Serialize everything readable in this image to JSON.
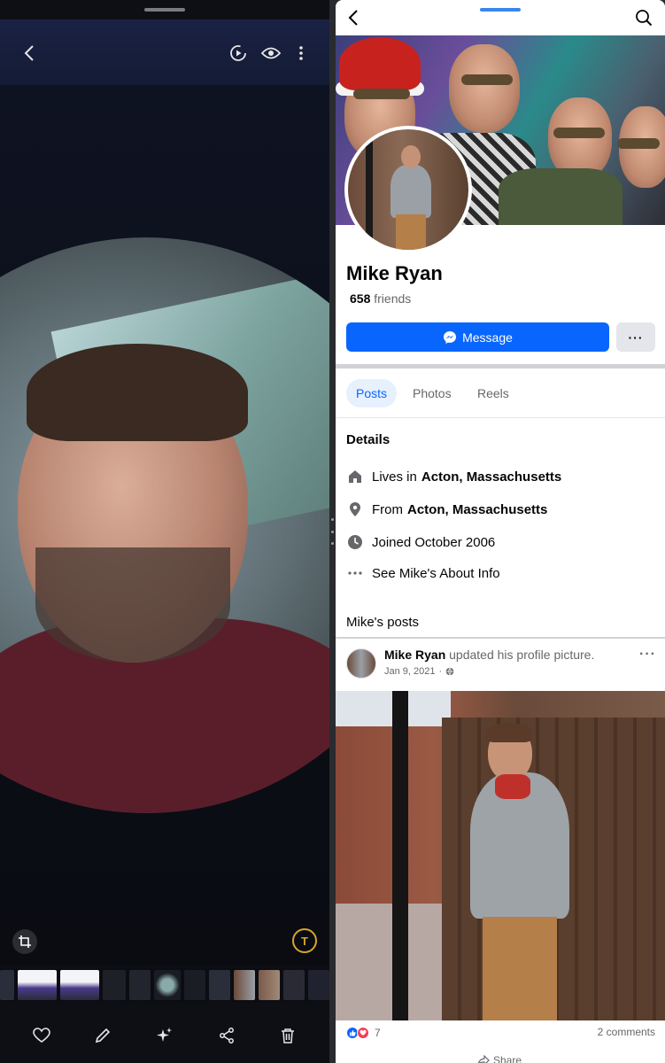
{
  "gallery": {
    "top_icons": [
      "back-icon",
      "motion-photo-icon",
      "eye-icon",
      "more-vertical-icon"
    ],
    "text_button_label": "T",
    "bottom_actions": [
      "heart-icon",
      "edit-icon",
      "sparkle-icon",
      "share-icon",
      "trash-icon"
    ],
    "filmstrip_count": 13
  },
  "facebook": {
    "profile": {
      "name": "Mike Ryan",
      "friends_count": "658",
      "friends_label": "friends"
    },
    "buttons": {
      "message": "Message",
      "more": "···"
    },
    "tabs": [
      {
        "label": "Posts",
        "active": true
      },
      {
        "label": "Photos",
        "active": false
      },
      {
        "label": "Reels",
        "active": false
      }
    ],
    "details": {
      "heading": "Details",
      "lives_prefix": "Lives in",
      "lives_value": "Acton, Massachusetts",
      "from_prefix": "From",
      "from_value": "Acton, Massachusetts",
      "joined": "Joined October 2006",
      "about": "See Mike's About Info"
    },
    "posts_heading": "Mike's posts",
    "post": {
      "author": "Mike Ryan",
      "action": "updated his profile picture.",
      "date": "Jan 9, 2021",
      "reactions_count": "7",
      "comments": "2 comments",
      "share_label": "Share"
    }
  },
  "colors": {
    "fb_blue": "#0866ff",
    "gallery_bg": "#0d0f14",
    "text_badge": "#d4a62a"
  }
}
